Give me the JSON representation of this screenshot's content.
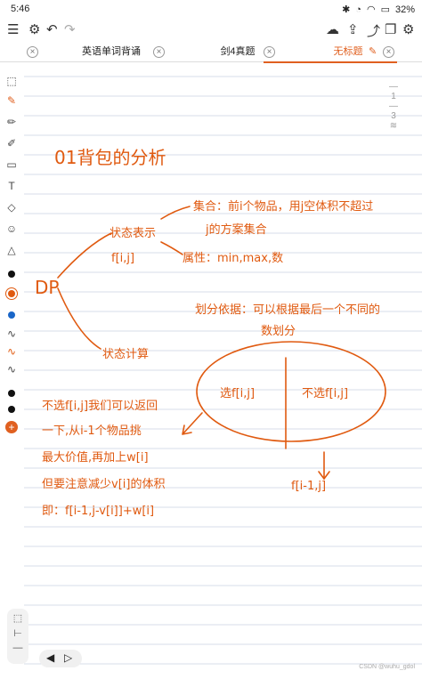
{
  "status": {
    "time": "5:46",
    "battery": "32%"
  },
  "tabs": [
    {
      "label": "英语单词背诵"
    },
    {
      "label": "剑4真题"
    },
    {
      "label": "无标题"
    }
  ],
  "pager": {
    "current": "1",
    "total": "3"
  },
  "note": {
    "title": "01背包的分析",
    "dp": "DP",
    "state_repr": "状态表示",
    "fij": "f[i,j]",
    "set_desc_1": "集合：前i个物品，用j空体积不超过",
    "set_desc_2": "j的方案集合",
    "attr": "属性：min,max,数",
    "divide_1": "划分依据：可以根据最后一个不同的",
    "divide_2": "数划分",
    "state_calc": "状态计算",
    "pick": "选f[i,j]",
    "nopick": "不选f[i,j]",
    "left_1": "不选f[i,j]我们可以返回",
    "left_2": "一下,从i-1个物品挑",
    "left_3": "最大价值,再加上w[i]",
    "left_4": "但要注意减少v[i]的体积",
    "left_5": "即：f[i-1,j-v[i]]+w[i]",
    "result": "f[i-1,j]"
  },
  "watermark": "CSDN @wuhu_gdol",
  "colors": {
    "ink": "#e05a10",
    "accent": "#e06020"
  }
}
